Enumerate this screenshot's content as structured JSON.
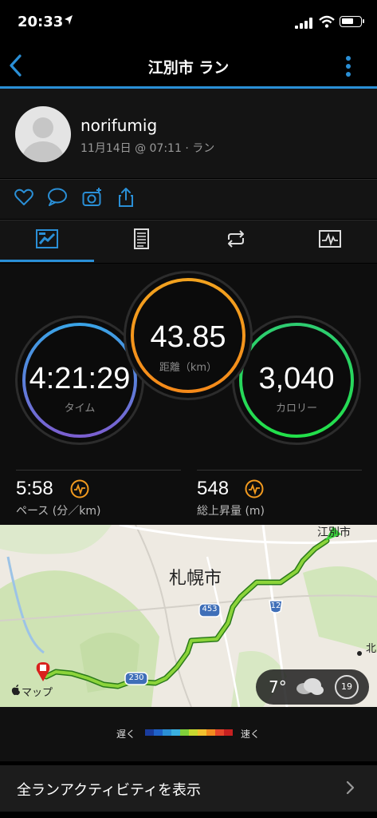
{
  "status_bar": {
    "time": "20:33",
    "location_arrow": "location-arrow-icon"
  },
  "nav": {
    "title": "江別市 ラン",
    "back_icon": "chevron-left-icon",
    "menu_icon": "more-vertical-icon",
    "accent": "#2a8fd6"
  },
  "profile": {
    "username": "norifumig",
    "meta": "11月14日 @ 07:11 · ラン"
  },
  "actions": [
    "heart-icon",
    "comment-icon",
    "camera-add-icon",
    "share-icon"
  ],
  "tabs": [
    "overview-tab-icon",
    "details-tab-icon",
    "laps-tab-icon",
    "charts-tab-icon"
  ],
  "stats": {
    "time": {
      "value": "4:21:29",
      "label": "タイム",
      "color": "#6e6ad6"
    },
    "distance": {
      "value": "43.85",
      "label": "距離（km）",
      "color": "#f29a1f"
    },
    "calories": {
      "value": "3,040",
      "label": "カロリー",
      "color": "#27c93f"
    }
  },
  "kpis": {
    "pace": {
      "value": "5:58",
      "label": "ペース (分／km)"
    },
    "elevation": {
      "value": "548",
      "label": "総上昇量 (m)"
    }
  },
  "map": {
    "city_label": "札幌市",
    "start_label": "江別市",
    "north_label": "北",
    "road_453": "453",
    "road_12": "12",
    "road_230": "230",
    "apple_maps": "マップ"
  },
  "weather": {
    "temp": "7°",
    "wind": "19"
  },
  "legend": {
    "slow": "遅く",
    "fast": "速く",
    "colors": [
      "#1a3c9e",
      "#1f62c9",
      "#2a8fd6",
      "#3ab0e0",
      "#7fcf3a",
      "#c8d830",
      "#f2c12e",
      "#f28c1f",
      "#e5462a",
      "#c62020"
    ]
  },
  "footer": {
    "label": "全ランアクティビティを表示"
  }
}
